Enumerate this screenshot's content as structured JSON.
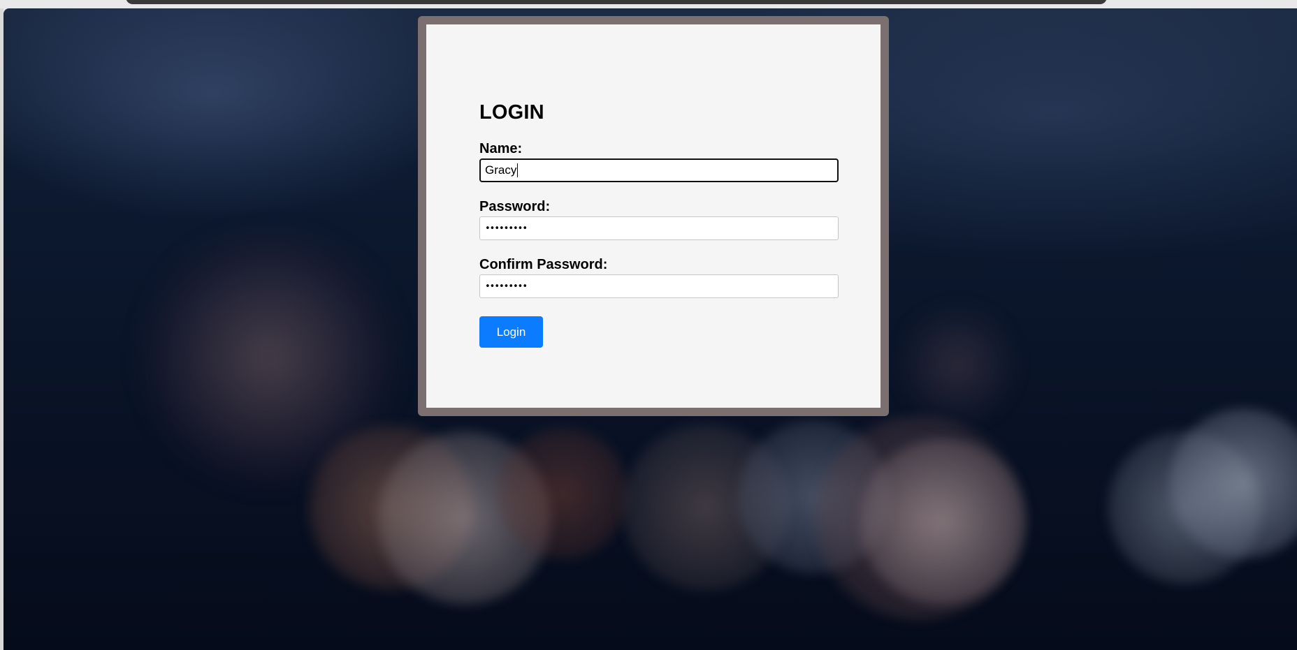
{
  "form": {
    "title": "LOGIN",
    "name_label": "Name:",
    "name_value": "Gracy",
    "password_label": "Password:",
    "password_value": "•••••••••",
    "confirm_label": "Confirm Password:",
    "confirm_value": "•••••••••",
    "submit_label": "Login"
  },
  "colors": {
    "button": "#0b7bff",
    "card_frame": "#7b6f6f",
    "card_background": "#f5f5f5"
  }
}
